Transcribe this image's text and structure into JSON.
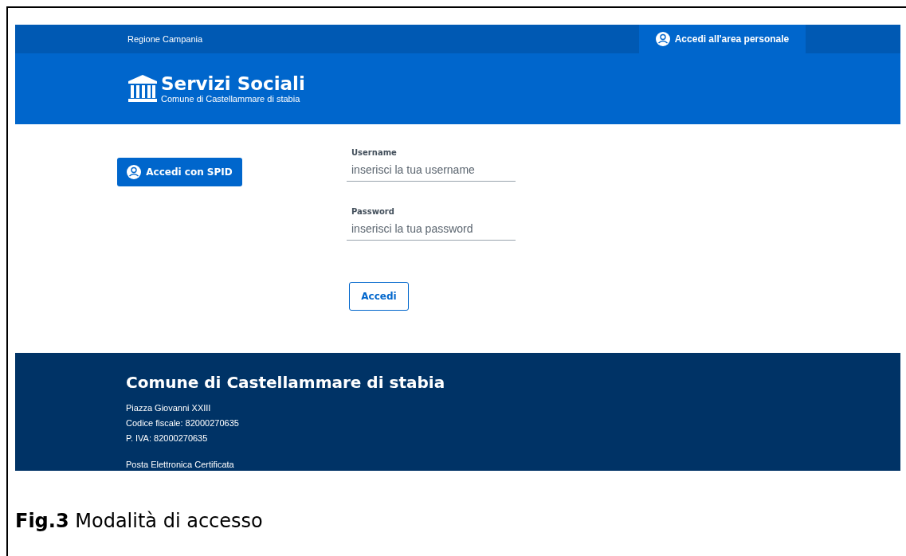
{
  "top_bar": {
    "region": "Regione Campania",
    "login_link": "Accedi all'area personale"
  },
  "header": {
    "title": "Servizi Sociali",
    "subtitle": "Comune di Castellammare di stabia"
  },
  "login": {
    "spid_button": "Accedi con SPID",
    "fields": [
      {
        "label": "Username",
        "placeholder": "inserisci la tua username"
      },
      {
        "label": "Password",
        "placeholder": "inserisci la tua password"
      }
    ],
    "submit": "Accedi"
  },
  "footer": {
    "title": "Comune di Castellammare di stabia",
    "lines": [
      "Piazza Giovanni XXIII",
      "Codice fiscale: 82000270635",
      "P. IVA: 82000270635"
    ],
    "pec": "Posta Elettronica Certificata"
  },
  "caption": "**Fig.3** Modalità di accesso"
}
